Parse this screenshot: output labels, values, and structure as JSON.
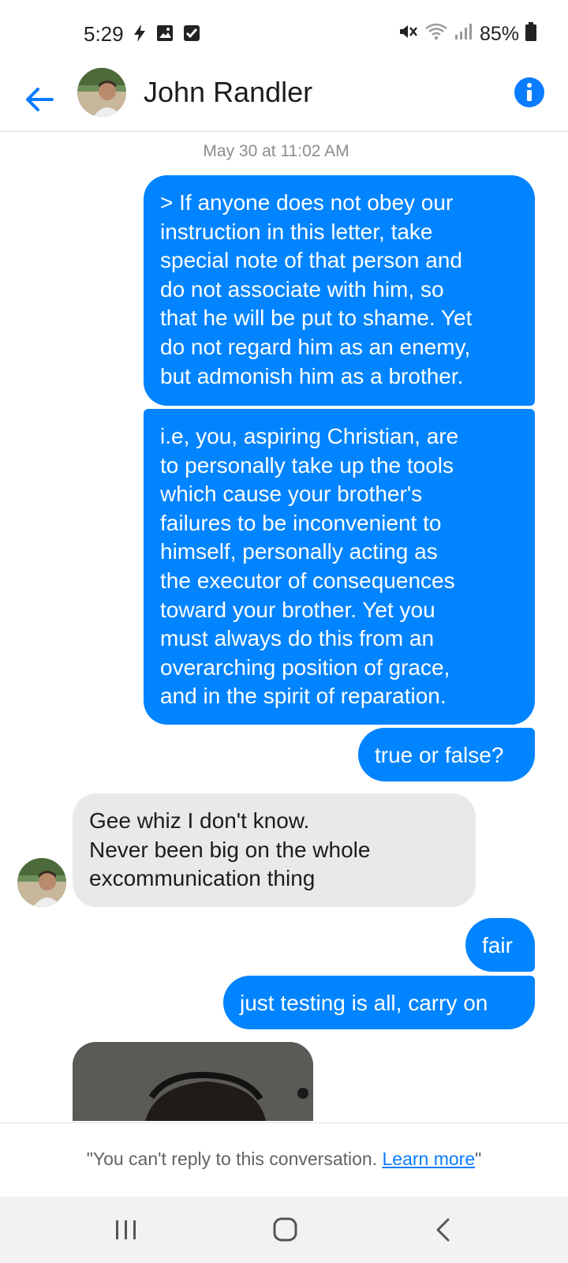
{
  "status_bar": {
    "time": "5:29",
    "battery": "85%",
    "icons_left": [
      "bolt-icon",
      "image-icon",
      "checkbox-icon"
    ],
    "icons_right": [
      "mute-icon",
      "wifi-icon",
      "signal-icon",
      "battery-icon"
    ]
  },
  "header": {
    "title": "John Randler",
    "back_icon": "arrow-left-icon",
    "info_icon": "info-icon",
    "accent_color": "#0a7cff"
  },
  "conversation": {
    "timestamp": "May 30 at 11:02 AM",
    "messages": [
      {
        "direction": "sent",
        "text": "> If anyone does not obey our\ninstruction in this letter, take\nspecial note of that person and\ndo not associate with him, so\nthat he will be put to shame. Yet\ndo not regard him as an enemy,\nbut admonish him as a brother."
      },
      {
        "direction": "sent",
        "text": "i.e, you, aspiring Christian, are\nto personally take up the tools\nwhich cause your brother's\nfailures to be inconvenient to\nhimself, personally acting as\nthe executor of consequences\ntoward your brother. Yet you\nmust always do this from an\noverarching position of grace,\nand in the spirit of reparation."
      },
      {
        "direction": "sent",
        "text": "true or false?"
      },
      {
        "direction": "received",
        "text": "Gee whiz I don't know.\nNever been big on the whole\nexcommunication thing"
      },
      {
        "direction": "sent",
        "text": "fair"
      },
      {
        "direction": "sent",
        "text": "just testing is all, carry on"
      }
    ],
    "sent_color": "#0084ff",
    "received_color": "#e9e9e9"
  },
  "footer": {
    "prefix": "\"You can't reply to this conversation. ",
    "link": "Learn more",
    "suffix": "\""
  },
  "nav_bar": {
    "buttons": [
      "recent-apps-icon",
      "home-icon",
      "back-icon"
    ]
  }
}
